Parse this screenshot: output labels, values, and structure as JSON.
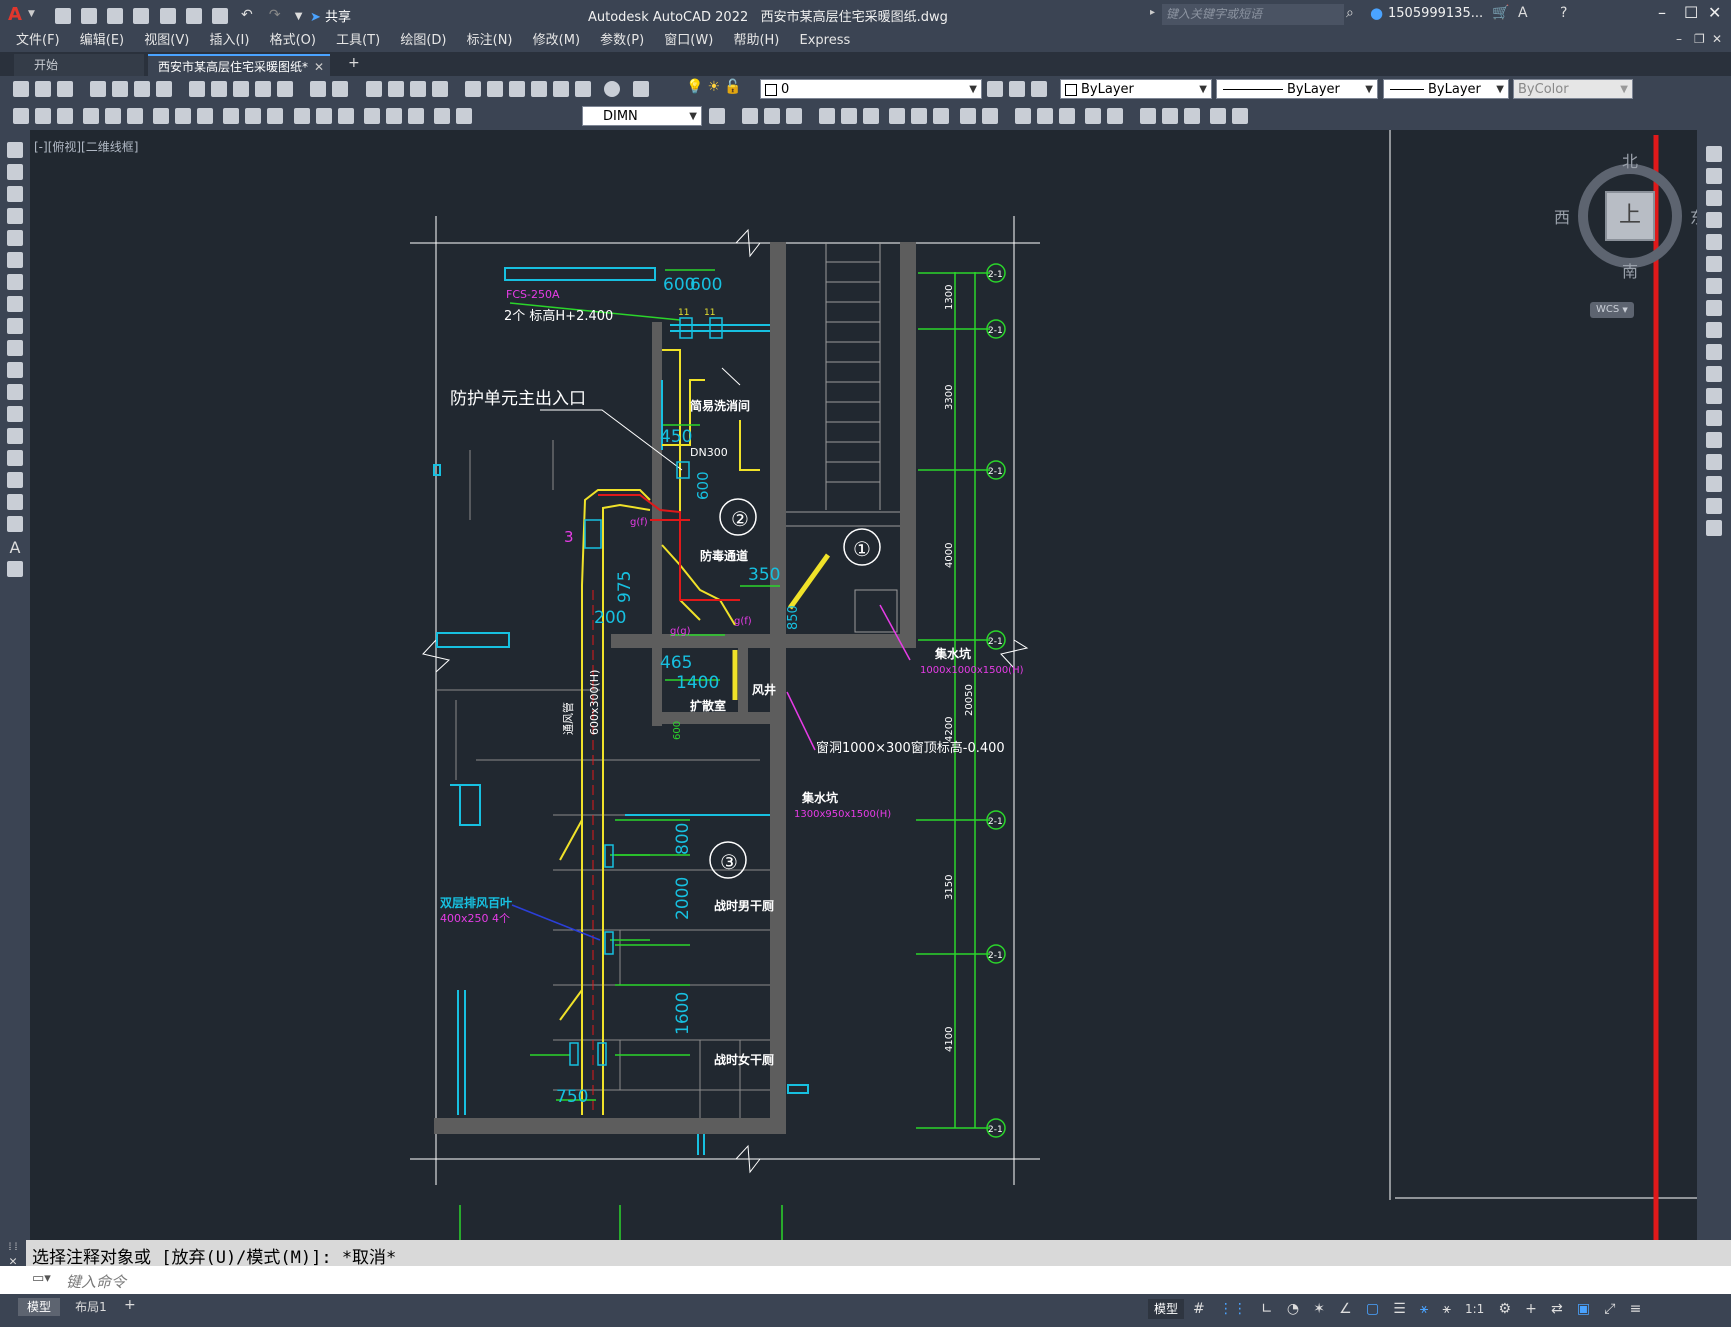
{
  "title_bar": {
    "app_title": "Autodesk AutoCAD 2022",
    "file_name": "西安市某高层住宅采暖图纸.dwg",
    "share_label": "共享",
    "search_placeholder": "键入关键字或短语",
    "user": "1505999135...",
    "help_glyph": "?"
  },
  "menu": [
    "文件(F)",
    "编辑(E)",
    "视图(V)",
    "插入(I)",
    "格式(O)",
    "工具(T)",
    "绘图(D)",
    "标注(N)",
    "修改(M)",
    "参数(P)",
    "窗口(W)",
    "帮助(H)",
    "Express"
  ],
  "doc_tabs": {
    "start": "开始",
    "active": "西安市某高层住宅采暖图纸*"
  },
  "toolbar": {
    "layer_value": "0",
    "color": "ByLayer",
    "linetype": "ByLayer",
    "lineweight": "ByLayer",
    "plotstyle": "ByColor",
    "dim_style": "DIMN"
  },
  "viewport_label": "[-][俯视][二维线框]",
  "viewcube": {
    "north": "北",
    "south": "南",
    "east": "东",
    "west": "西",
    "face": "上",
    "wcs": "WCS"
  },
  "drawing": {
    "labels": {
      "fcs": "FCS-250A",
      "fcs_note": "2个 标高H+2.400",
      "entrance": "防护单元主出入口",
      "wash_room": "简易洗消间",
      "dn300": "DN300",
      "gas_corridor": "防毒通道",
      "expansion_room": "扩散室",
      "wind": "风井",
      "window_note": "窗洞1000×300窗顶标高-0.400",
      "sump1": "集水坑",
      "sump1_dim": "1000x1000x1500(H)",
      "sump2": "集水坑",
      "sump2_dim": "1300x950x1500(H)",
      "male_toilet": "战时男干厕",
      "female_toilet": "战时女干厕",
      "louver": "双层排风百叶",
      "louver_dim": "400x250 4个",
      "duct": "600x300(H)",
      "duct_text": "通风管",
      "num3": "3",
      "g1": "g(f)",
      "g2": "g(f)",
      "g3": "g(g)"
    },
    "circles": [
      "①",
      "②",
      "③"
    ],
    "dims": [
      "600",
      "600",
      "11",
      "11",
      "450",
      "600",
      "350",
      "975",
      "200",
      "465",
      "1400",
      "800",
      "2000",
      "1600",
      "750",
      "850",
      "600"
    ],
    "axis_dims": [
      "1300",
      "3300",
      "4000",
      "4200",
      "3150",
      "4100",
      "20050"
    ],
    "grid_label": "2-1"
  },
  "command": {
    "history": "选择注释对象或 [放弃(U)/模式(M)]: *取消*",
    "placeholder": "键入命令"
  },
  "status": {
    "tabs": [
      "模型",
      "布局1"
    ],
    "model_label": "模型",
    "scale": "1:1"
  }
}
